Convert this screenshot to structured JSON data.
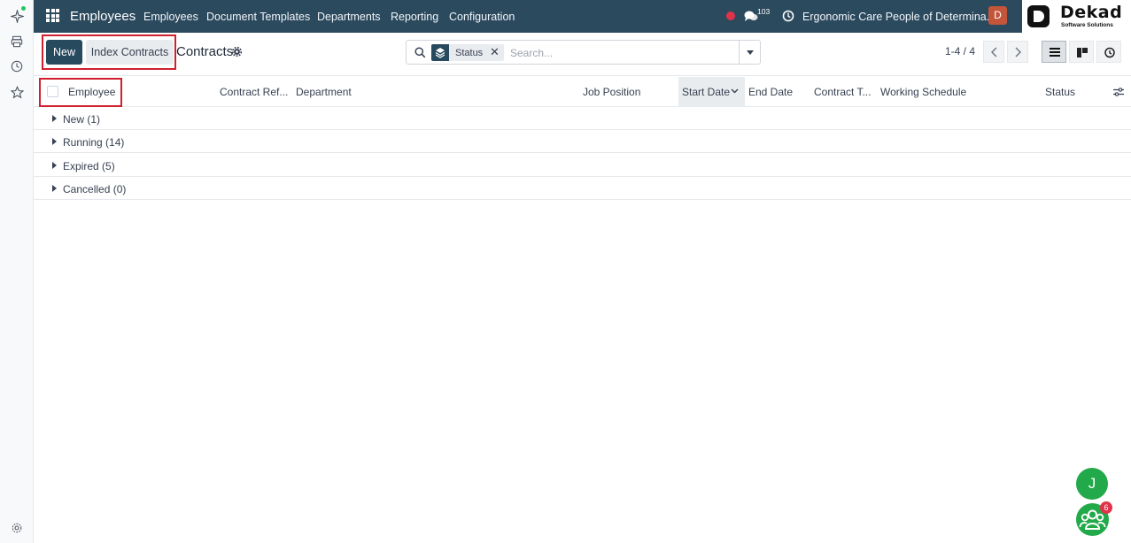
{
  "navbar": {
    "brand": "Employees",
    "menu": [
      "Employees",
      "Document Templates",
      "Departments",
      "Reporting",
      "Configuration"
    ],
    "chat_count": "103",
    "company": "Ergonomic Care People of Determina...",
    "avatar_letter": "D",
    "logo_name": "Dekad",
    "logo_tagline": "Software Solutions"
  },
  "toolbar": {
    "new_label": "New",
    "index_label": "Index Contracts",
    "title": "Contracts"
  },
  "search": {
    "facet_label": "Status",
    "facet_remove": "✕",
    "placeholder": "Search..."
  },
  "pager": {
    "value": "1-4 / 4"
  },
  "table": {
    "columns": [
      "Employee",
      "Contract Ref...",
      "Department",
      "Job Position",
      "Start Date",
      "End Date",
      "Contract T...",
      "Working Schedule",
      "Status"
    ],
    "sorted_column": "Start Date",
    "groups": [
      {
        "label": "New (1)"
      },
      {
        "label": "Running (14)"
      },
      {
        "label": "Expired (5)"
      },
      {
        "label": "Cancelled (0)"
      }
    ]
  },
  "floating": {
    "user_letter": "J",
    "team_badge": "6"
  },
  "colors": {
    "navbar": "#2c4a5e",
    "primary": "#274a5e",
    "highlight": "#d0202f",
    "bubble": "#22a94a"
  }
}
